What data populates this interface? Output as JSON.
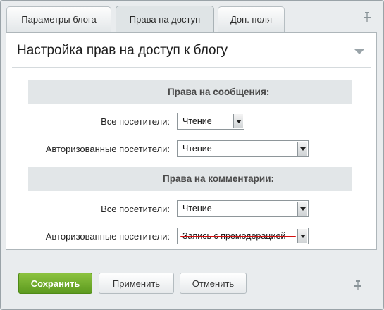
{
  "tabs": [
    {
      "label": "Параметры блога",
      "active": false
    },
    {
      "label": "Права на доступ",
      "active": true
    },
    {
      "label": "Доп. поля",
      "active": false
    }
  ],
  "panel": {
    "title": "Настройка прав на доступ к блогу"
  },
  "sections": [
    {
      "title": "Права на сообщения:",
      "rows": [
        {
          "label": "Все посетители:",
          "value": "Чтение"
        },
        {
          "label": "Авторизованные посетители:",
          "value": "Чтение"
        }
      ]
    },
    {
      "title": "Права на комментарии:",
      "rows": [
        {
          "label": "Все посетители:",
          "value": "Чтение"
        },
        {
          "label": "Авторизованные посетители:",
          "value": "Запись с премодерацией"
        }
      ]
    }
  ],
  "highlight_color": "#d40f0f",
  "buttons": {
    "save": "Сохранить",
    "apply": "Применить",
    "cancel": "Отменить"
  },
  "icons": {
    "pin": "pin-icon",
    "collapse": "collapse-arrow-icon",
    "dropdown": "chevron-down-icon"
  }
}
